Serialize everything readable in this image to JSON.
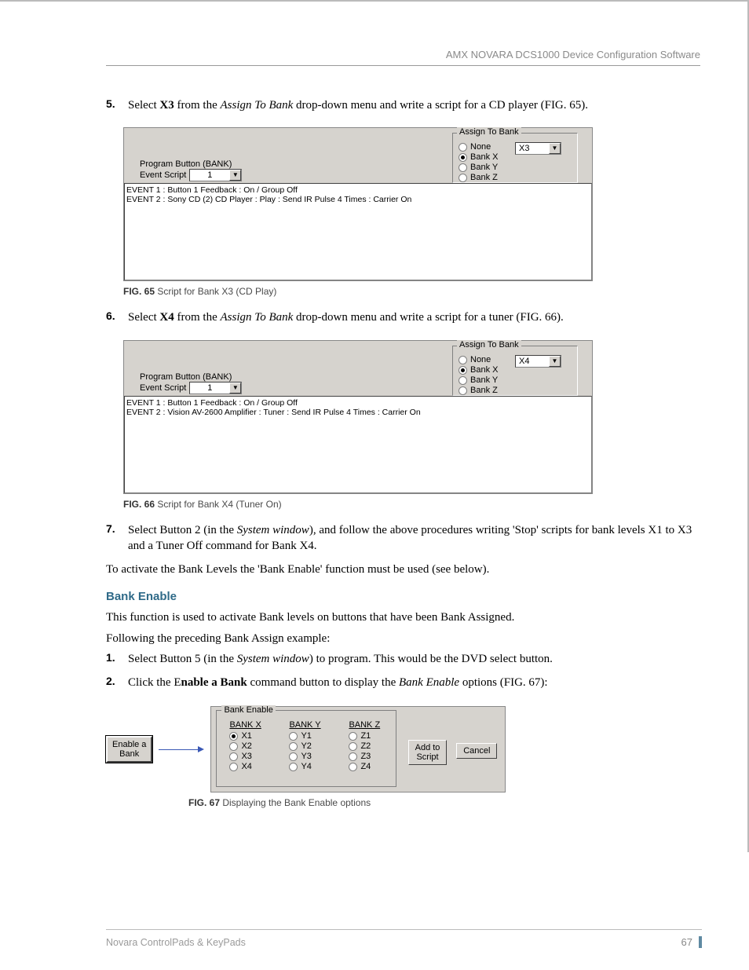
{
  "header": {
    "title": "AMX NOVARA DCS1000 Device Configuration Software"
  },
  "steps": {
    "s5": {
      "num": "5.",
      "pre": "Select ",
      "bold": "X3",
      "mid": " from the ",
      "ital": "Assign To Bank",
      "post": " drop-down menu and write a script for a CD player (FIG. 65)."
    },
    "s6": {
      "num": "6.",
      "pre": "Select ",
      "bold": "X4",
      "mid": " from the ",
      "ital": "Assign To Bank",
      "post": " drop-down menu and write a script for a tuner (FIG. 66)."
    },
    "s7": {
      "num": "7.",
      "pre": "Select Button 2 (in the ",
      "ital": "System window",
      "post": "), and follow the above procedures writing 'Stop' scripts for bank levels X1 to X3 and a Tuner Off command for Bank X4."
    },
    "b1": {
      "num": "1.",
      "pre": "Select Button 5 (in the ",
      "ital": "System window",
      "post": ") to program. This would be the DVD select button."
    },
    "b2": {
      "num": "2.",
      "pre": "Click the E",
      "bold": "nable a Bank",
      "post2": " command button to display the ",
      "ital": "Bank Enable",
      "post": " options (FIG. 67):"
    }
  },
  "fig65": {
    "tab": "Program Button (BANK)",
    "eventScriptLabel": "Event Script",
    "eventScriptValue": "1",
    "assignLegend": "Assign To Bank",
    "radioNone": "None",
    "radioX": "Bank X",
    "radioY": "Bank Y",
    "radioZ": "Bank Z",
    "selectValue": "X3",
    "list": {
      "r1": "EVENT 1 : Button 1 Feedback : On / Group Off",
      "r2": "EVENT 2 : Sony CD (2)   CD Player :  Play  : Send IR Pulse 4 Times : Carrier On"
    },
    "caption": {
      "label": "FIG. 65",
      "text": "  Script for Bank X3 (CD Play)"
    }
  },
  "fig66": {
    "tab": "Program Button (BANK)",
    "eventScriptLabel": "Event Script",
    "eventScriptValue": "1",
    "assignLegend": "Assign To Bank",
    "radioNone": "None",
    "radioX": "Bank X",
    "radioY": "Bank Y",
    "radioZ": "Bank Z",
    "selectValue": "X4",
    "list": {
      "r1": "EVENT 1 : Button 1 Feedback : On / Group Off",
      "r2": "EVENT 2 : Vision AV-2600   Amplifier :  Tuner  : Send IR Pulse 4 Times : Carrier On"
    },
    "caption": {
      "label": "FIG. 66",
      "text": "  Script for Bank X4 (Tuner On)"
    }
  },
  "para1": "To activate the Bank Levels the 'Bank Enable' function must be used (see below).",
  "section": "Bank Enable",
  "para2": "This function is used to activate Bank levels on buttons that have been Bank Assigned.",
  "para3": "Following the preceding Bank Assign example:",
  "fig67": {
    "enableBtn": "Enable a\nBank",
    "legend": "Bank Enable",
    "colX": {
      "hdr": "BANK X",
      "r1": "X1",
      "r2": "X2",
      "r3": "X3",
      "r4": "X4"
    },
    "colY": {
      "hdr": "BANK Y",
      "r1": "Y1",
      "r2": "Y2",
      "r3": "Y3",
      "r4": "Y4"
    },
    "colZ": {
      "hdr": "BANK Z",
      "r1": "Z1",
      "r2": "Z2",
      "r3": "Z3",
      "r4": "Z4"
    },
    "addBtn": "Add to\nScript",
    "cancelBtn": "Cancel",
    "caption": {
      "label": "FIG. 67",
      "text": "  Displaying the Bank Enable options"
    }
  },
  "footer": {
    "left": "Novara ControlPads & KeyPads",
    "page": "67"
  }
}
